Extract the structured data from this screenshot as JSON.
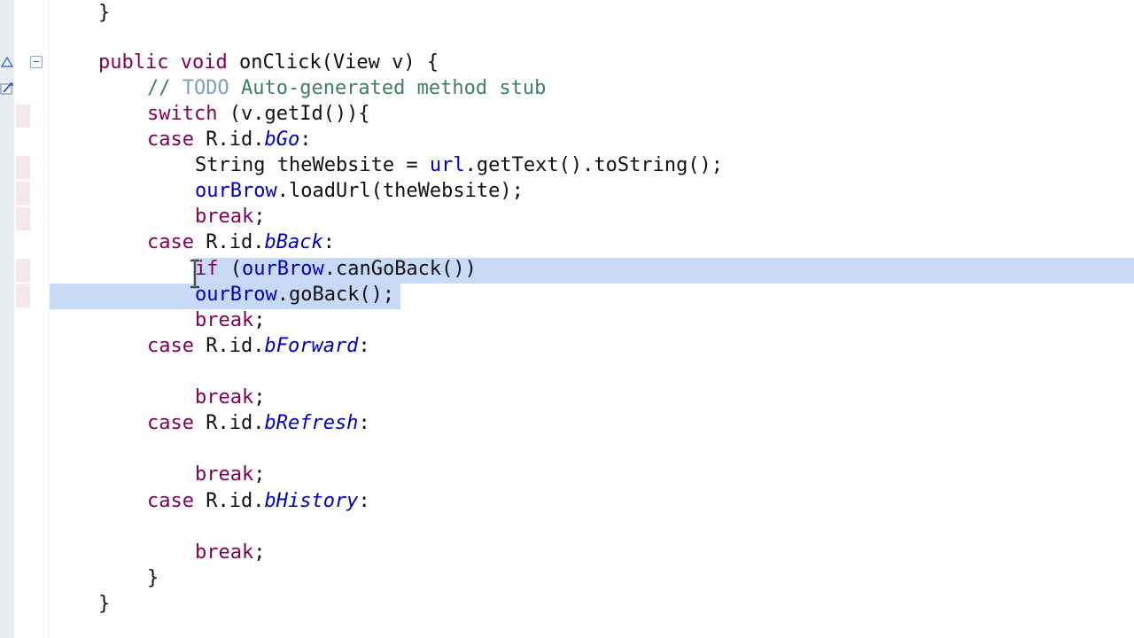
{
  "editor": {
    "lines": [
      {
        "id": "l1",
        "tokens": [
          {
            "t": "}",
            "c": "plain"
          }
        ]
      },
      {
        "id": "l2",
        "tokens": [
          {
            "t": "public void",
            "c": "kw"
          },
          {
            "t": " onClick(View v) {",
            "c": "plain"
          }
        ]
      },
      {
        "id": "l3",
        "tokens": [
          {
            "t": "// ",
            "c": "cmt"
          },
          {
            "t": "TODO",
            "c": "todo"
          },
          {
            "t": " Auto-generated method stub",
            "c": "cmt"
          }
        ]
      },
      {
        "id": "l4",
        "tokens": [
          {
            "t": "switch",
            "c": "kw"
          },
          {
            "t": " (v.getId()){",
            "c": "plain"
          }
        ]
      },
      {
        "id": "l5",
        "tokens": [
          {
            "t": "case",
            "c": "kw"
          },
          {
            "t": " R.id.",
            "c": "plain"
          },
          {
            "t": "bGo",
            "c": "ifld"
          },
          {
            "t": ":",
            "c": "plain"
          }
        ]
      },
      {
        "id": "l6",
        "tokens": [
          {
            "t": "String theWebsite = ",
            "c": "plain"
          },
          {
            "t": "url",
            "c": "fld"
          },
          {
            "t": ".getText().toString();",
            "c": "plain"
          }
        ]
      },
      {
        "id": "l7",
        "tokens": [
          {
            "t": "ourBrow",
            "c": "fld"
          },
          {
            "t": ".loadUrl(theWebsite);",
            "c": "plain"
          }
        ]
      },
      {
        "id": "l8",
        "tokens": [
          {
            "t": "break",
            "c": "kw"
          },
          {
            "t": ";",
            "c": "plain"
          }
        ]
      },
      {
        "id": "l9",
        "tokens": [
          {
            "t": "case",
            "c": "kw"
          },
          {
            "t": " R.id.",
            "c": "plain"
          },
          {
            "t": "bBack",
            "c": "ifld"
          },
          {
            "t": ":",
            "c": "plain"
          }
        ]
      },
      {
        "id": "l10",
        "tokens": [
          {
            "t": "if",
            "c": "kw"
          },
          {
            "t": " (",
            "c": "plain"
          },
          {
            "t": "ourBrow",
            "c": "fld"
          },
          {
            "t": ".canGoBack())",
            "c": "plain"
          }
        ]
      },
      {
        "id": "l11",
        "tokens": [
          {
            "t": "ourBrow",
            "c": "fld"
          },
          {
            "t": ".goBack();",
            "c": "plain"
          }
        ]
      },
      {
        "id": "l12",
        "tokens": [
          {
            "t": "break",
            "c": "kw"
          },
          {
            "t": ";",
            "c": "plain"
          }
        ]
      },
      {
        "id": "l13",
        "tokens": [
          {
            "t": "case",
            "c": "kw"
          },
          {
            "t": " R.id.",
            "c": "plain"
          },
          {
            "t": "bForward",
            "c": "ifld"
          },
          {
            "t": ":",
            "c": "plain"
          }
        ]
      },
      {
        "id": "l14",
        "tokens": [
          {
            "t": "break",
            "c": "kw"
          },
          {
            "t": ";",
            "c": "plain"
          }
        ]
      },
      {
        "id": "l15",
        "tokens": [
          {
            "t": "case",
            "c": "kw"
          },
          {
            "t": " R.id.",
            "c": "plain"
          },
          {
            "t": "bRefresh",
            "c": "ifld"
          },
          {
            "t": ":",
            "c": "plain"
          }
        ]
      },
      {
        "id": "l16",
        "tokens": [
          {
            "t": "break",
            "c": "kw"
          },
          {
            "t": ";",
            "c": "plain"
          }
        ]
      },
      {
        "id": "l17",
        "tokens": [
          {
            "t": "case",
            "c": "kw"
          },
          {
            "t": " R.id.",
            "c": "plain"
          },
          {
            "t": "bHistory",
            "c": "ifld"
          },
          {
            "t": ":",
            "c": "plain"
          }
        ]
      },
      {
        "id": "l18",
        "tokens": [
          {
            "t": "break",
            "c": "kw"
          },
          {
            "t": ";",
            "c": "plain"
          }
        ]
      },
      {
        "id": "l19",
        "tokens": [
          {
            "t": "}",
            "c": "plain"
          }
        ]
      },
      {
        "id": "l20",
        "tokens": [
          {
            "t": "}",
            "c": "plain"
          }
        ]
      }
    ]
  },
  "colors": {
    "keyword": "#7f0055",
    "field": "#0000c0",
    "comment": "#3f7f5f",
    "todo": "#7f9fbf",
    "selection": "#c8d9f5"
  },
  "gutter": {
    "icons": [
      "override-triangle-icon",
      "quick-fix-icon"
    ],
    "collapse_icon": "collapse-minus-icon"
  },
  "pointer": "i-beam-cursor-icon"
}
